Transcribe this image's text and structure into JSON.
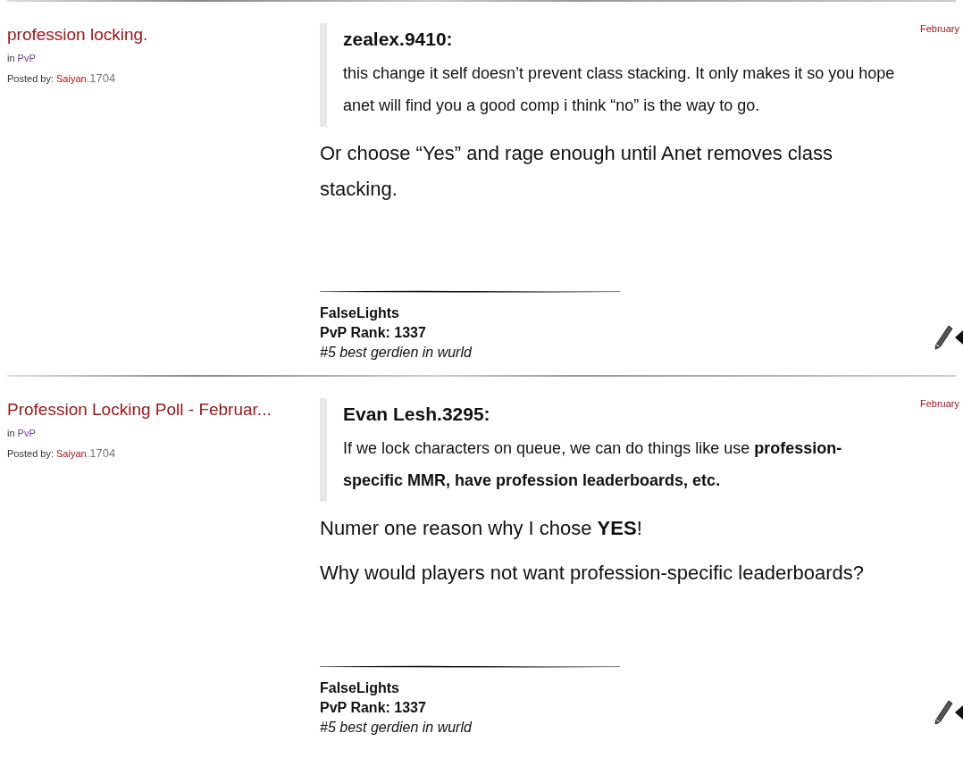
{
  "posts": [
    {
      "title": "profession locking.",
      "in_label": "in",
      "category": "PvP",
      "posted_by_label": "Posted by:",
      "author": "Saiyan",
      "author_id": ".1704",
      "date": "February",
      "quote": {
        "author": "zealex.9410:",
        "text": "this change it self doesn’t prevent class stacking. It only makes it so you hope anet will find you a good comp i think “no” is the way to go."
      },
      "paragraphs": [
        "Or choose “Yes” and rage enough until Anet removes class stacking."
      ],
      "signature": {
        "name": "FalseLights",
        "rank": "PvP Rank: 1337",
        "tagline": "#5 best gerdien in wurld"
      }
    },
    {
      "title": "Profession Locking Poll - Februar...",
      "in_label": "in",
      "category": "PvP",
      "posted_by_label": "Posted by:",
      "author": "Saiyan",
      "author_id": ".1704",
      "date": "February",
      "quote": {
        "author": "Evan Lesh.3295:",
        "text": "If we lock characters on queue, we can do things like use **profession-specific MMR, have profession leaderboards, etc.**"
      },
      "paragraphs": [
        "Numer one reason why I chose **YES**!",
        "Why would players not want profession-specific leaderboards?"
      ],
      "signature": {
        "name": "FalseLights",
        "rank": "PvP Rank: 1337",
        "tagline": "#5 best gerdien in wurld"
      }
    }
  ]
}
